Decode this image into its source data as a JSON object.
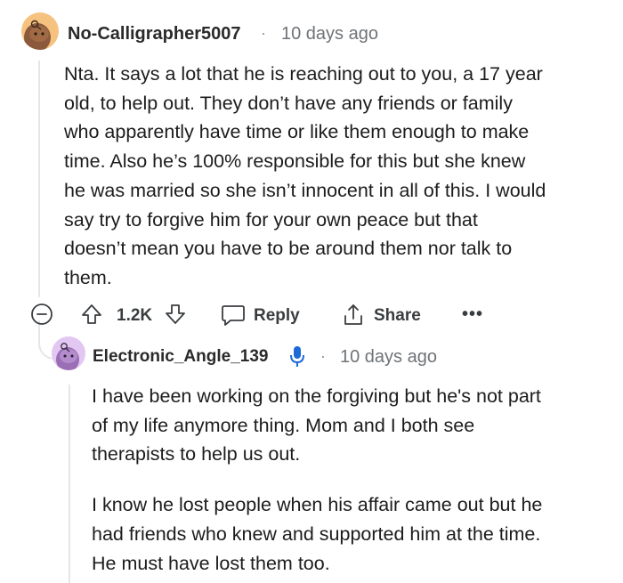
{
  "comment": {
    "username": "No-Calligrapher5007",
    "separator": "·",
    "time": "10 days ago",
    "lines": [
      "Nta. It says a lot that he is reaching out to you, a 17 year",
      "old, to help out. They don’t have any friends or family",
      "who apparently have time or like them enough to make",
      "time. Also he’s 100% responsible for this but she knew",
      "he was married so she isn’t innocent in all of this. I would",
      "say try to forgive him for your own peace but that",
      "doesn’t mean you have to be around them nor talk to",
      "them."
    ],
    "avatar_icon": "snoo-avatar-icon",
    "avatar_color": "#f6c27f"
  },
  "actions": {
    "collapse_icon": "minus-circle-icon",
    "upvote_icon": "arrow-up-icon",
    "vote_count": "1.2K",
    "downvote_icon": "arrow-down-icon",
    "reply_icon": "speech-bubble-icon",
    "reply_label": "Reply",
    "share_icon": "share-icon",
    "share_label": "Share",
    "more_label": "•••"
  },
  "reply": {
    "username": "Electronic_Angle_139",
    "badge_icon": "microphone-icon",
    "separator": "·",
    "time": "10 days ago",
    "paragraph1": [
      "I have been working on the forgiving but he's not part",
      "of my life anymore thing. Mom and I both see",
      "therapists to help us out."
    ],
    "paragraph2": [
      "I know he lost people when his affair came out but he",
      "had friends who knew and supported him at the time.",
      "He must have lost them too."
    ],
    "avatar_icon": "snoo-avatar-icon",
    "avatar_color": "#e2c7f2",
    "badge_color": "#1e6ad6"
  }
}
